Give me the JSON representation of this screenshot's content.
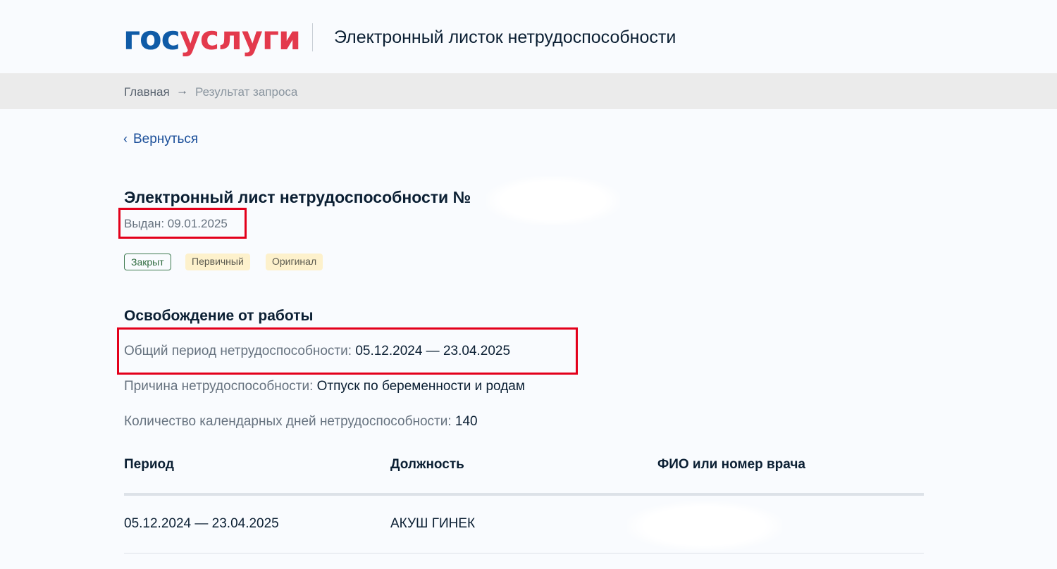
{
  "header": {
    "logo_part1": "гос",
    "logo_part2": "услуги",
    "title": "Электронный листок нетрудоспособности",
    "colors": {
      "logo_blue": "#0f5ba7",
      "logo_red": "#e3394c"
    }
  },
  "breadcrumb": {
    "home": "Главная",
    "separator_icon": "arrow-right-icon",
    "current": "Результат запроса"
  },
  "back": {
    "icon": "chevron-left-icon",
    "label": "Вернуться"
  },
  "document": {
    "title": "Электронный лист нетрудоспособности №",
    "issued": "Выдан: 09.01.2025",
    "tags": [
      "Закрыт",
      "Первичный",
      "Оригинал"
    ]
  },
  "release": {
    "title": "Освобождение от работы",
    "period_label": "Общий период нетрудоспособности:",
    "period_value": "05.12.2024 — 23.04.2025",
    "reason_label": "Причина нетрудоспособности:",
    "reason_value": "Отпуск по беременности и родам",
    "days_label": "Количество календарных дней нетрудоспособности:",
    "days_value": "140"
  },
  "table": {
    "headers": [
      "Период",
      "Должность",
      "ФИО или номер врача"
    ],
    "rows": [
      [
        "05.12.2024 — 23.04.2025",
        "АКУШ ГИНЕК",
        ""
      ]
    ]
  },
  "annotation_color": "#e3001b"
}
